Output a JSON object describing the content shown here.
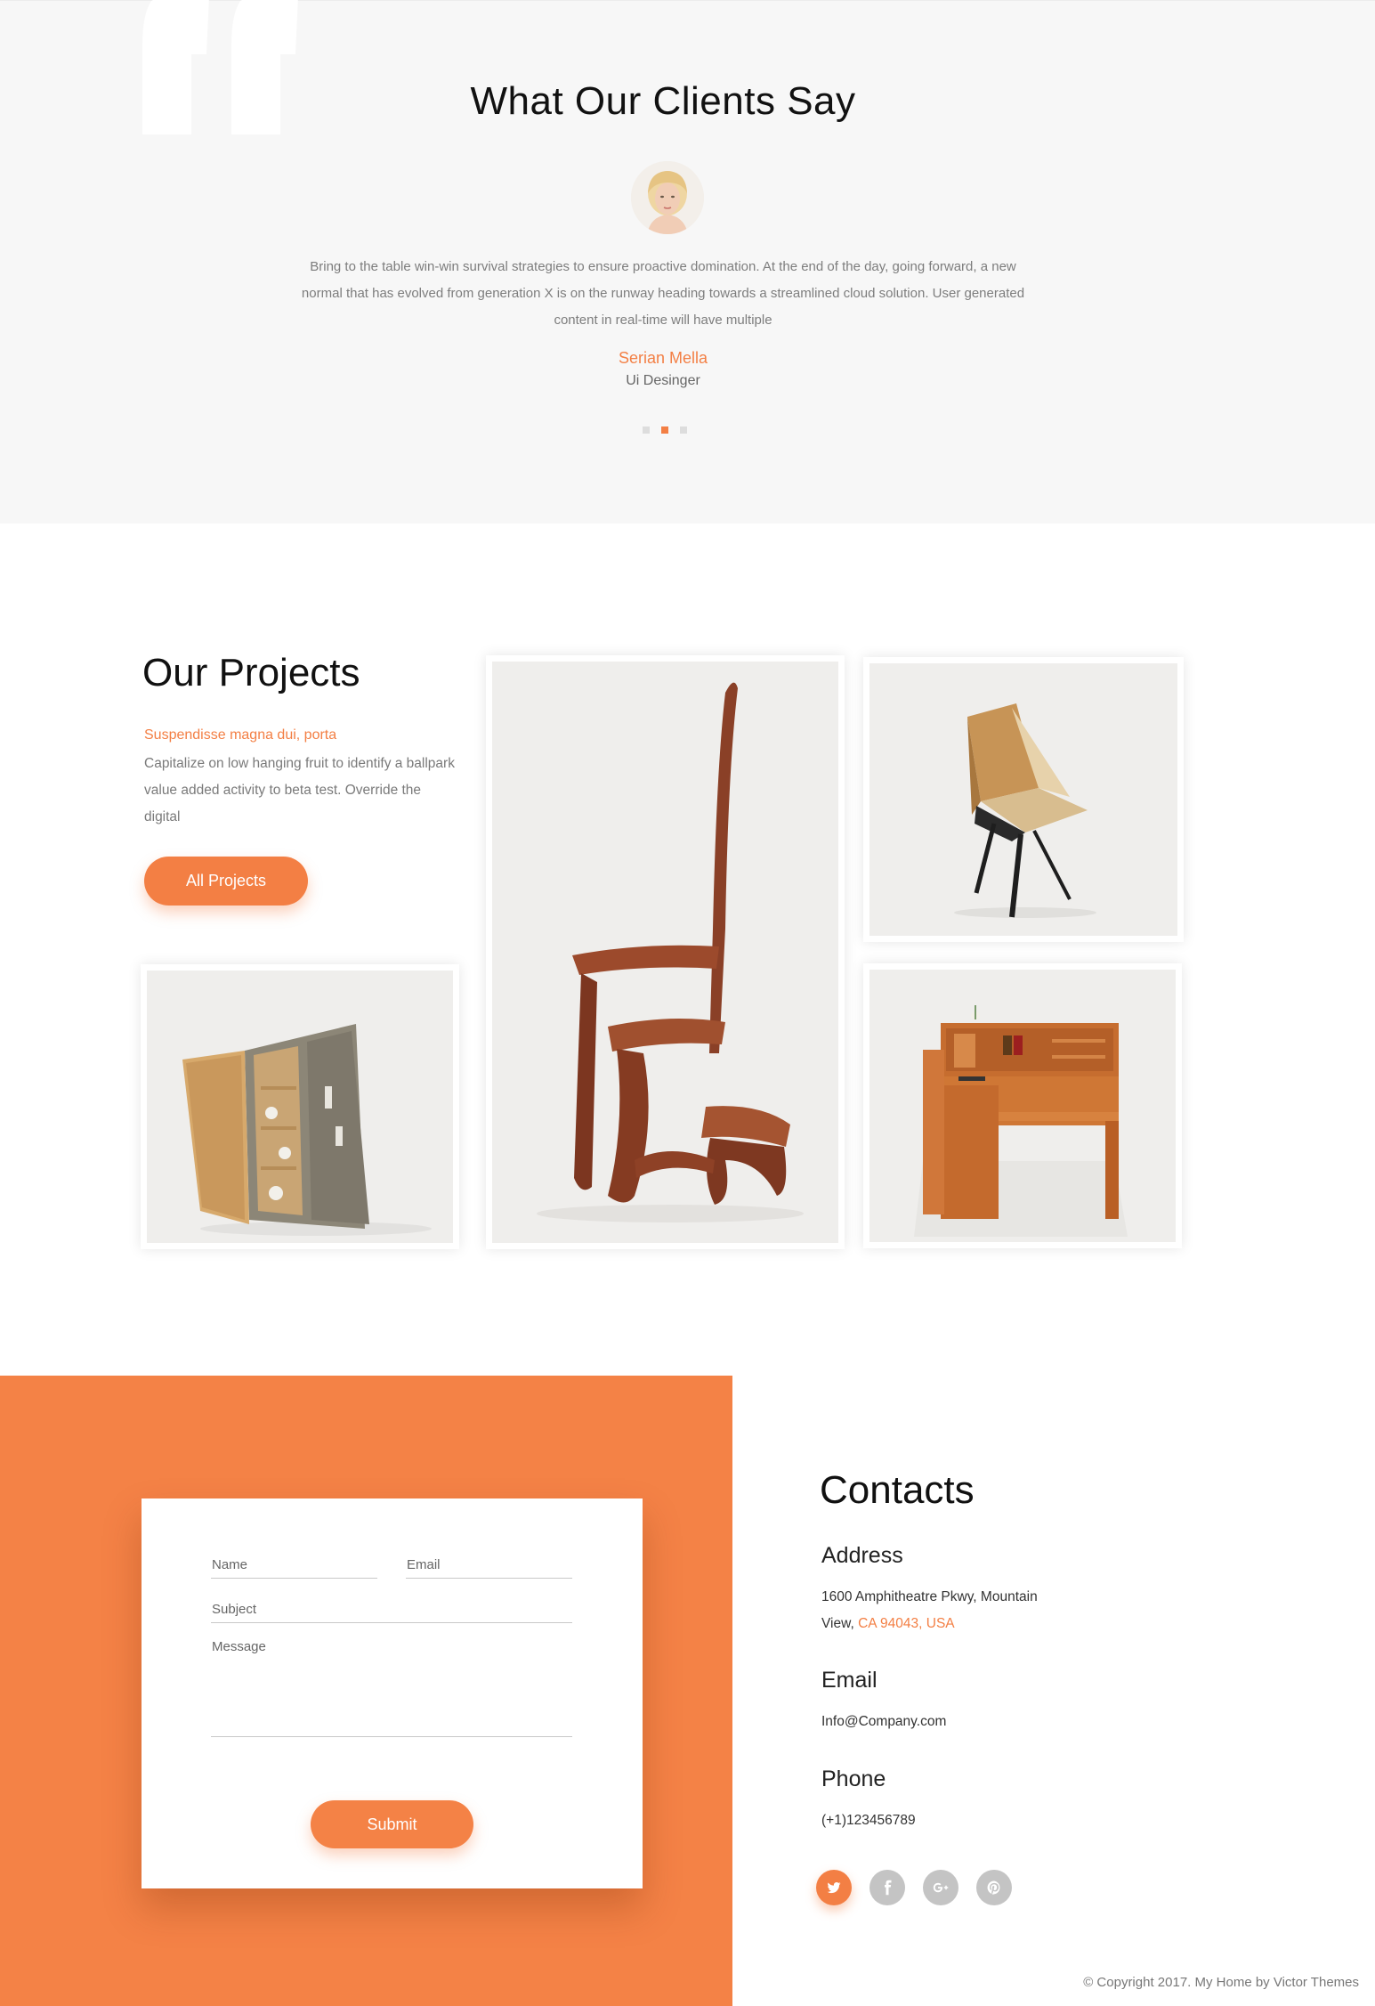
{
  "testimonials": {
    "title": "What Our Clients Say",
    "quote": "Bring to the table win-win survival strategies to ensure proactive domination. At the end of the day, going forward, a new normal that has evolved from generation X is on the runway heading towards a streamlined cloud solution. User generated content in real-time will have multiple",
    "name": "Serian Mella",
    "role": "Ui Desinger",
    "slides_count": 3,
    "active_slide": 2
  },
  "projects": {
    "title": "Our Projects",
    "subtitle": "Suspendisse magna dui, porta",
    "text": "Capitalize on low hanging fruit to identify a ballpark value added activity to beta test. Override the digital",
    "button_label": "All Projects",
    "items": [
      "cabinet",
      "library-step-stool",
      "geometric-chair",
      "wooden-desk"
    ]
  },
  "contact_form": {
    "name_placeholder": "Name",
    "email_placeholder": "Email",
    "subject_placeholder": "Subject",
    "message_placeholder": "Message",
    "submit_label": "Submit"
  },
  "contacts": {
    "title": "Contacts",
    "address_label": "Address",
    "address_line1": "1600 Amphitheatre Pkwy, Mountain",
    "address_line2_prefix": "View, ",
    "address_line2_highlight": "CA 94043, USA",
    "email_label": "Email",
    "email_value": "Info@Company.com",
    "phone_label": "Phone",
    "phone_value": "(+1)123456789",
    "socials": [
      "twitter-icon",
      "facebook-icon",
      "google-plus-icon",
      "pinterest-icon"
    ]
  },
  "footer": {
    "copyright": "© Copyright 2017. My Home by Victor Themes"
  },
  "colors": {
    "accent": "#f37f44",
    "orange_panel": "#f48246",
    "testimonial_bg": "#f7f7f7"
  }
}
